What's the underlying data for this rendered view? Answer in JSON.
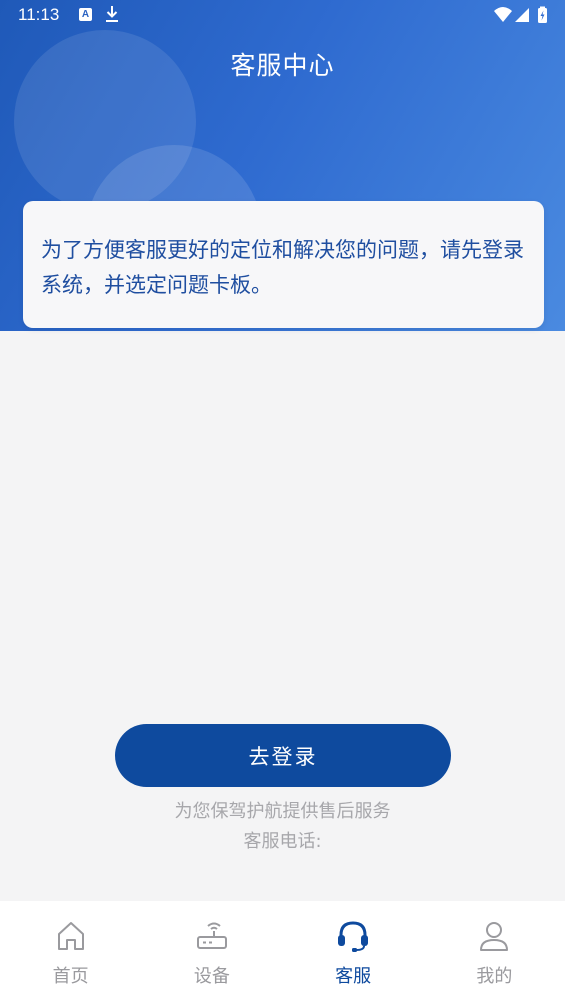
{
  "status_bar": {
    "time": "11:13",
    "notification_icons": [
      "a-icon",
      "download-icon"
    ],
    "system_icons": [
      "wifi-icon",
      "signal-icon",
      "battery-charging-icon"
    ]
  },
  "header": {
    "title": "客服中心"
  },
  "notice": {
    "text": "为了方便客服更好的定位和解决您的问题，请先登录系统，并选定问题卡板。"
  },
  "login": {
    "button_label": "去登录"
  },
  "footer_info": {
    "slogan": "为您保驾护航提供售后服务",
    "hotline": "客服电话:"
  },
  "tab_bar": {
    "active_index": 2,
    "tabs": [
      {
        "label": "首页",
        "icon": "home-icon"
      },
      {
        "label": "设备",
        "icon": "router-icon"
      },
      {
        "label": "客服",
        "icon": "headset-icon"
      },
      {
        "label": "我的",
        "icon": "user-icon"
      }
    ]
  },
  "colors": {
    "primary": "#0e4a9e",
    "header_gradient_start": "#1f59b8",
    "header_gradient_end": "#4a8ae0",
    "notice_text": "#1f4ea0",
    "muted_text": "#a7a7ab",
    "background": "#f4f4f5"
  }
}
